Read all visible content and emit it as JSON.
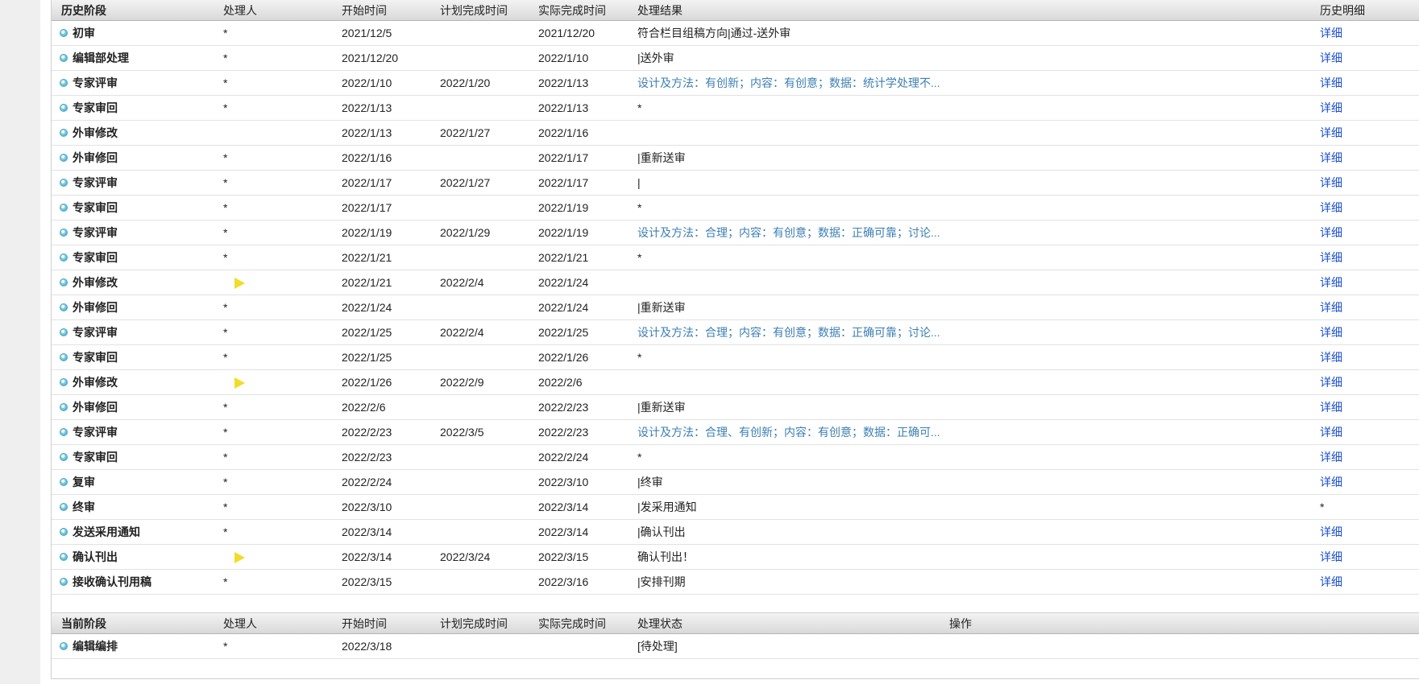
{
  "history": {
    "headers": [
      "历史阶段",
      "处理人",
      "开始时间",
      "计划完成时间",
      "实际完成时间",
      "处理结果",
      "历史明细"
    ],
    "rows": [
      {
        "stage": "初审",
        "handler": "*",
        "start": "2021/12/5",
        "planned": "",
        "actual": "2021/12/20",
        "result": "符合栏目组稿方向|通过-送外审",
        "result_link": false,
        "detail": "详细",
        "detail_link": true,
        "marker": false
      },
      {
        "stage": "编辑部处理",
        "handler": "*",
        "start": "2021/12/20",
        "planned": "",
        "actual": "2022/1/10",
        "result": "|送外审",
        "result_link": false,
        "detail": "详细",
        "detail_link": true,
        "marker": false
      },
      {
        "stage": "专家评审",
        "handler": "*",
        "start": "2022/1/10",
        "planned": "2022/1/20",
        "actual": "2022/1/13",
        "result": "设计及方法：有创新；内容：有创意；数据：统计学处理不...",
        "result_link": true,
        "detail": "详细",
        "detail_link": true,
        "marker": false
      },
      {
        "stage": "专家审回",
        "handler": "*",
        "start": "2022/1/13",
        "planned": "",
        "actual": "2022/1/13",
        "result": "*",
        "result_link": false,
        "detail": "详细",
        "detail_link": true,
        "marker": false
      },
      {
        "stage": "外审修改",
        "handler": "",
        "start": "2022/1/13",
        "planned": "2022/1/27",
        "actual": "2022/1/16",
        "result": "",
        "result_link": false,
        "detail": "详细",
        "detail_link": true,
        "marker": false
      },
      {
        "stage": "外审修回",
        "handler": "*",
        "start": "2022/1/16",
        "planned": "",
        "actual": "2022/1/17",
        "result": "|重新送审",
        "result_link": false,
        "detail": "详细",
        "detail_link": true,
        "marker": false
      },
      {
        "stage": "专家评审",
        "handler": "*",
        "start": "2022/1/17",
        "planned": "2022/1/27",
        "actual": "2022/1/17",
        "result": "|",
        "result_link": false,
        "detail": "详细",
        "detail_link": true,
        "marker": false
      },
      {
        "stage": "专家审回",
        "handler": "*",
        "start": "2022/1/17",
        "planned": "",
        "actual": "2022/1/19",
        "result": "*",
        "result_link": false,
        "detail": "详细",
        "detail_link": true,
        "marker": false
      },
      {
        "stage": "专家评审",
        "handler": "*",
        "start": "2022/1/19",
        "planned": "2022/1/29",
        "actual": "2022/1/19",
        "result": "设计及方法：合理；内容：有创意；数据：正确可靠；讨论...",
        "result_link": true,
        "detail": "详细",
        "detail_link": true,
        "marker": false
      },
      {
        "stage": "专家审回",
        "handler": "*",
        "start": "2022/1/21",
        "planned": "",
        "actual": "2022/1/21",
        "result": "*",
        "result_link": false,
        "detail": "详细",
        "detail_link": true,
        "marker": false
      },
      {
        "stage": "外审修改",
        "handler": "",
        "start": "2022/1/21",
        "planned": "2022/2/4",
        "actual": "2022/1/24",
        "result": "",
        "result_link": false,
        "detail": "详细",
        "detail_link": true,
        "marker": true
      },
      {
        "stage": "外审修回",
        "handler": "*",
        "start": "2022/1/24",
        "planned": "",
        "actual": "2022/1/24",
        "result": "|重新送审",
        "result_link": false,
        "detail": "详细",
        "detail_link": true,
        "marker": false
      },
      {
        "stage": "专家评审",
        "handler": "*",
        "start": "2022/1/25",
        "planned": "2022/2/4",
        "actual": "2022/1/25",
        "result": "设计及方法：合理；内容：有创意；数据：正确可靠；讨论...",
        "result_link": true,
        "detail": "详细",
        "detail_link": true,
        "marker": false
      },
      {
        "stage": "专家审回",
        "handler": "*",
        "start": "2022/1/25",
        "planned": "",
        "actual": "2022/1/26",
        "result": "*",
        "result_link": false,
        "detail": "详细",
        "detail_link": true,
        "marker": false
      },
      {
        "stage": "外审修改",
        "handler": "",
        "start": "2022/1/26",
        "planned": "2022/2/9",
        "actual": "2022/2/6",
        "result": "",
        "result_link": false,
        "detail": "详细",
        "detail_link": true,
        "marker": true
      },
      {
        "stage": "外审修回",
        "handler": "*",
        "start": "2022/2/6",
        "planned": "",
        "actual": "2022/2/23",
        "result": "|重新送审",
        "result_link": false,
        "detail": "详细",
        "detail_link": true,
        "marker": false
      },
      {
        "stage": "专家评审",
        "handler": "*",
        "start": "2022/2/23",
        "planned": "2022/3/5",
        "actual": "2022/2/23",
        "result": "设计及方法：合理、有创新；内容：有创意；数据：正确可...",
        "result_link": true,
        "detail": "详细",
        "detail_link": true,
        "marker": false
      },
      {
        "stage": "专家审回",
        "handler": "*",
        "start": "2022/2/23",
        "planned": "",
        "actual": "2022/2/24",
        "result": "*",
        "result_link": false,
        "detail": "详细",
        "detail_link": true,
        "marker": false
      },
      {
        "stage": "复审",
        "handler": "*",
        "start": "2022/2/24",
        "planned": "",
        "actual": "2022/3/10",
        "result": "|终审",
        "result_link": false,
        "detail": "详细",
        "detail_link": true,
        "marker": false
      },
      {
        "stage": "终审",
        "handler": "*",
        "start": "2022/3/10",
        "planned": "",
        "actual": "2022/3/14",
        "result": "|发采用通知",
        "result_link": false,
        "detail": "*",
        "detail_link": false,
        "marker": false
      },
      {
        "stage": "发送采用通知",
        "handler": "*",
        "start": "2022/3/14",
        "planned": "",
        "actual": "2022/3/14",
        "result": "|确认刊出",
        "result_link": false,
        "detail": "详细",
        "detail_link": true,
        "marker": false
      },
      {
        "stage": "确认刊出",
        "handler": "",
        "start": "2022/3/14",
        "planned": "2022/3/24",
        "actual": "2022/3/15",
        "result": "确认刊出！",
        "result_link": false,
        "detail": "详细",
        "detail_link": true,
        "marker": true
      },
      {
        "stage": "接收确认刊用稿",
        "handler": "*",
        "start": "2022/3/15",
        "planned": "",
        "actual": "2022/3/16",
        "result": "|安排刊期",
        "result_link": false,
        "detail": "详细",
        "detail_link": true,
        "marker": false
      }
    ]
  },
  "current": {
    "headers": [
      "当前阶段",
      "处理人",
      "开始时间",
      "计划完成时间",
      "实际完成时间",
      "处理状态",
      "操作"
    ],
    "rows": [
      {
        "stage": "编辑编排",
        "handler": "*",
        "start": "2022/3/18",
        "planned": "",
        "actual": "",
        "status": "[待处理]",
        "action": ""
      }
    ]
  },
  "colors": {
    "link": "#1a4fd0",
    "result_link": "#3c7fb4",
    "marker": "#f2dc27",
    "bullet": "#3aa2c9"
  },
  "icons": {
    "row_bullet": "circle-bullet-icon",
    "marker": "yellow-arrow-icon"
  }
}
